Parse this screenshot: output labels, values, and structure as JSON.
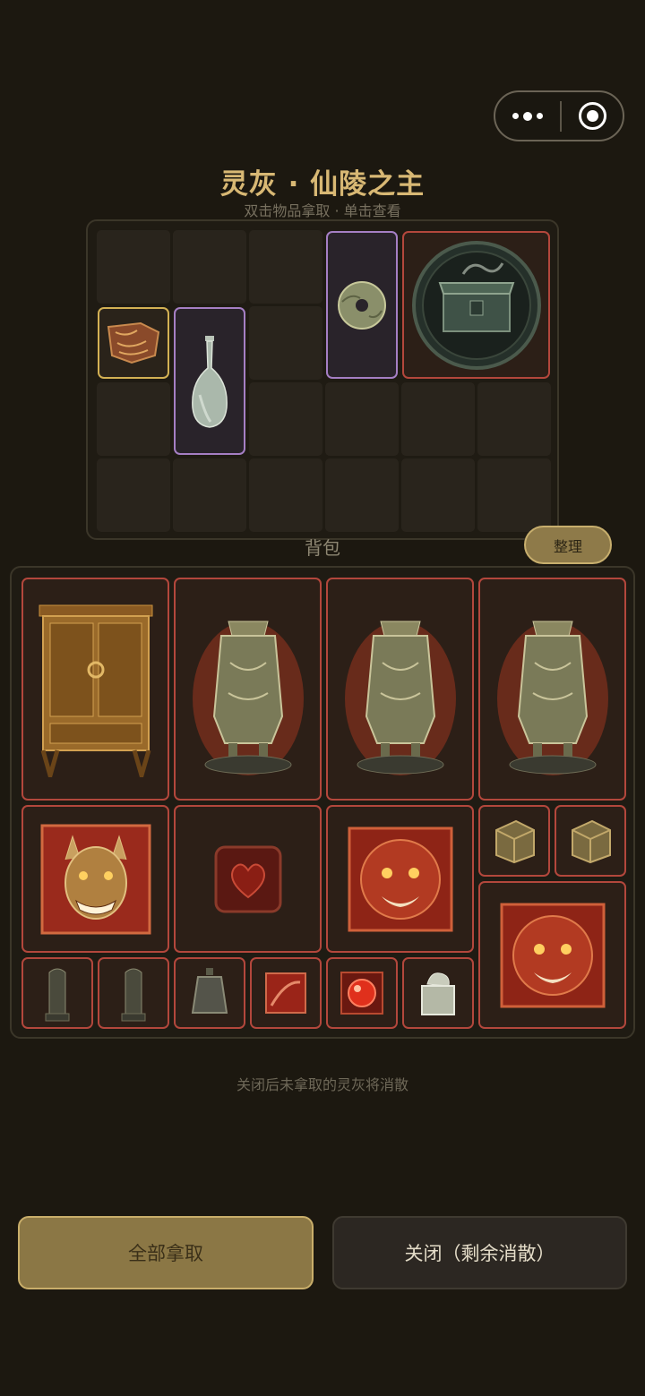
{
  "capsule": {
    "more_icon": "more-dots-icon",
    "close_icon": "target-ring-icon"
  },
  "header": {
    "title": "灵灰 · 仙陵之主",
    "subtitle": "双击物品拿取 · 单击查看"
  },
  "loot": {
    "items": [
      {
        "name": "carved-tile-fragment",
        "rarity": "gold",
        "icon": "carved-tile-icon"
      },
      {
        "name": "celadon-vase",
        "rarity": "purple",
        "icon": "vase-icon"
      },
      {
        "name": "jade-bi-disc",
        "rarity": "purple",
        "icon": "jade-disc-icon"
      },
      {
        "name": "bronze-treasure-chest",
        "rarity": "red",
        "icon": "chest-icon"
      }
    ]
  },
  "bag": {
    "label": "背包",
    "sort_label": "整理",
    "items": [
      {
        "name": "wooden-cabinet",
        "icon": "cabinet-icon"
      },
      {
        "name": "bronze-fangyi-1",
        "icon": "bronze-vessel-icon"
      },
      {
        "name": "bronze-fangyi-2",
        "icon": "bronze-vessel-icon"
      },
      {
        "name": "bronze-fangyi-3",
        "icon": "bronze-vessel-icon"
      },
      {
        "name": "oni-mask-plaque",
        "icon": "demon-mask-icon"
      },
      {
        "name": "crimson-heart-cube",
        "icon": "heart-cube-icon"
      },
      {
        "name": "lion-mask-plaque-1",
        "icon": "lion-mask-icon"
      },
      {
        "name": "bronze-cube-1",
        "icon": "bronze-cube-icon"
      },
      {
        "name": "bronze-cube-2",
        "icon": "bronze-cube-icon"
      },
      {
        "name": "lion-mask-plaque-2",
        "icon": "lion-mask-icon"
      },
      {
        "name": "stone-stele-1",
        "icon": "stele-icon"
      },
      {
        "name": "stone-stele-2",
        "icon": "stele-icon"
      },
      {
        "name": "bronze-bell",
        "icon": "bell-icon"
      },
      {
        "name": "red-gem-plate",
        "icon": "red-plate-icon"
      },
      {
        "name": "red-orb",
        "icon": "red-orb-icon"
      },
      {
        "name": "jade-seal",
        "icon": "jade-seal-icon"
      }
    ]
  },
  "footer": {
    "note": "关闭后未拿取的灵灰将消散",
    "take_all_label": "全部拿取",
    "close_label": "关闭（剩余消散）"
  },
  "colors": {
    "background": "#1c1810",
    "accent_gold": "#d8b874",
    "rarity_gold": "#d3b154",
    "rarity_purple": "#a57fc4",
    "rarity_red": "#b3473c"
  }
}
